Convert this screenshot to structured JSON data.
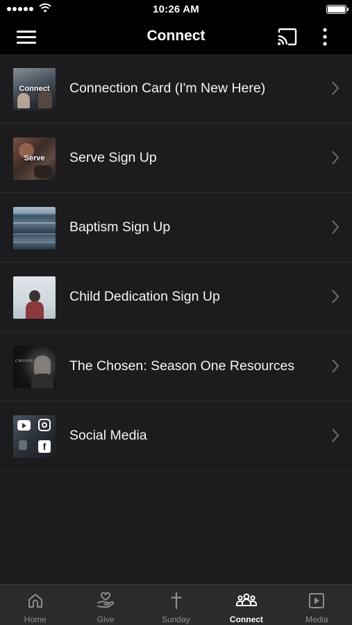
{
  "status_bar": {
    "time": "10:26 AM"
  },
  "nav": {
    "title": "Connect"
  },
  "items": [
    {
      "label": "Connection Card (I'm New Here)",
      "thumb_text": "Connect"
    },
    {
      "label": "Serve Sign Up",
      "thumb_text": "Serve"
    },
    {
      "label": "Baptism Sign Up",
      "thumb_text": ""
    },
    {
      "label": "Child Dedication Sign Up",
      "thumb_text": ""
    },
    {
      "label": "The Chosen: Season One Resources",
      "thumb_text": "CHOSEN"
    },
    {
      "label": "Social Media",
      "thumb_text": ""
    }
  ],
  "tabs": [
    {
      "label": "Home",
      "icon": "home-icon",
      "active": false
    },
    {
      "label": "Give",
      "icon": "give-icon",
      "active": false
    },
    {
      "label": "Sunday",
      "icon": "cross-icon",
      "active": false
    },
    {
      "label": "Connect",
      "icon": "people-icon",
      "active": true
    },
    {
      "label": "Media",
      "icon": "play-icon",
      "active": false
    }
  ],
  "colors": {
    "background": "#1c1c1e",
    "bar": "#000000",
    "tab_bar": "#2b2b2e",
    "tab_inactive": "#8e8e93",
    "tab_active": "#ffffff"
  }
}
